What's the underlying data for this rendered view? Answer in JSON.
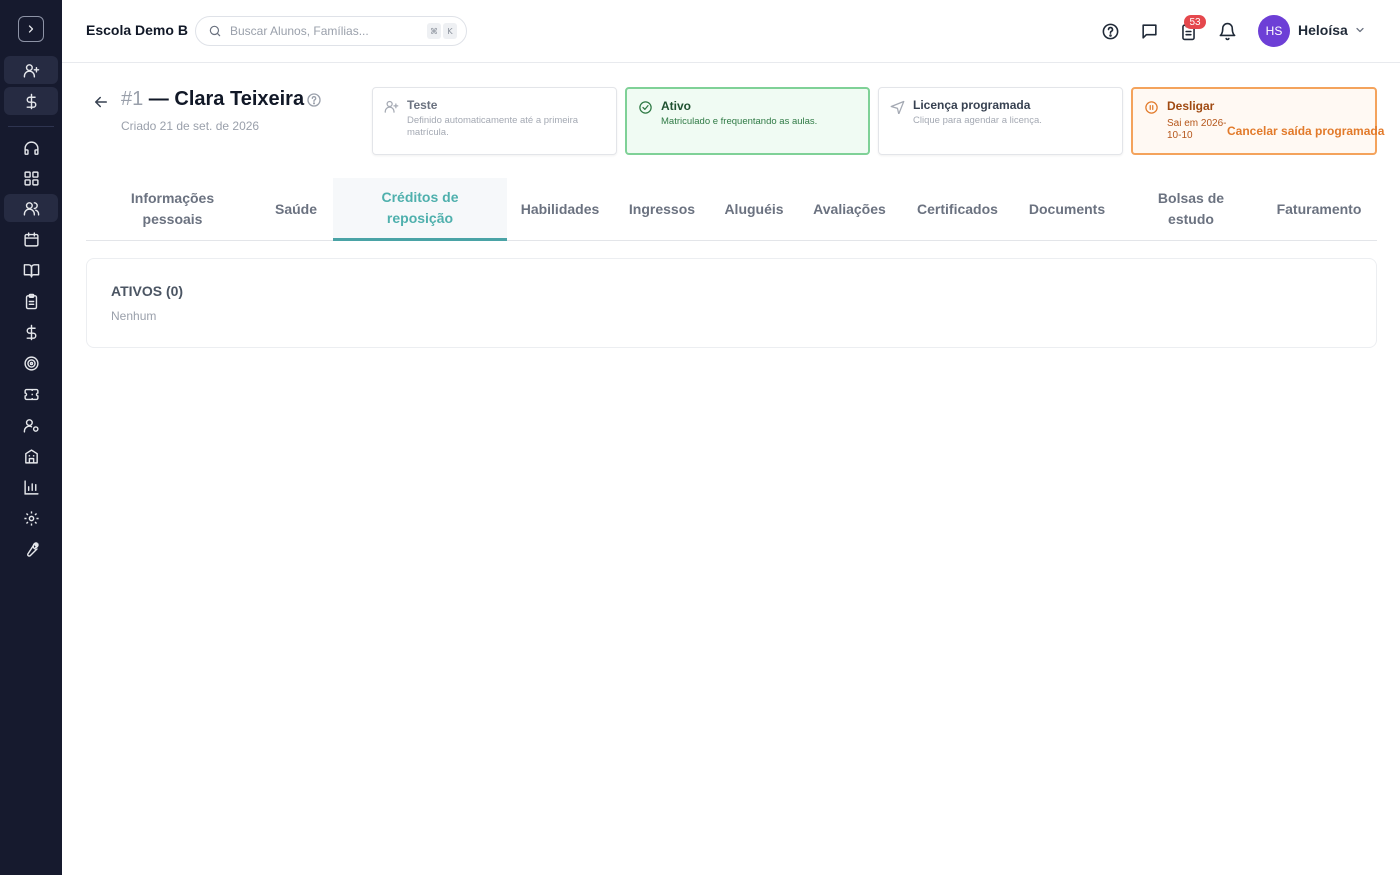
{
  "app": {
    "school_name": "Escola Demo B",
    "search": {
      "placeholder": "Buscar Alunos, Famílias...",
      "shortcut": [
        "⌘",
        "K"
      ]
    },
    "notifications_badge": "53",
    "user": {
      "initials": "HS",
      "name": "Heloísa",
      "avatar_color": "#6d3fd6"
    }
  },
  "sidebar": {
    "icons": [
      "chevron-right-icon",
      "user-plus-icon",
      "dollar-icon",
      "headset-icon",
      "grid-icon",
      "users-icon",
      "calendar-icon",
      "book-open-icon",
      "clipboard-icon",
      "dollar-icon",
      "target-icon",
      "ticket-icon",
      "user-cog-icon",
      "building-icon",
      "bar-chart-icon",
      "settings-icon",
      "wrench-icon"
    ]
  },
  "student": {
    "number": "#1",
    "separator": " — ",
    "name": "Clara Teixeira",
    "created": "Criado 21 de set. de 2026"
  },
  "statuses": {
    "test": {
      "title": "Teste",
      "desc": "Definido automaticamente até a primeira matrícula."
    },
    "active": {
      "title": "Ativo",
      "desc": "Matriculado e frequentando as aulas."
    },
    "leave": {
      "title": "Licença programada",
      "desc": "Clique para agendar a licença."
    },
    "off": {
      "title": "Desligar",
      "desc": "Sai em 2026-10-10",
      "action": "Cancelar saída programada"
    }
  },
  "tabs": [
    {
      "label": "Informações pessoais"
    },
    {
      "label": "Saúde"
    },
    {
      "label": "Créditos de reposição"
    },
    {
      "label": "Habilidades"
    },
    {
      "label": "Ingressos"
    },
    {
      "label": "Aluguéis"
    },
    {
      "label": "Avaliações"
    },
    {
      "label": "Certificados"
    },
    {
      "label": "Documents"
    },
    {
      "label": "Bolsas de estudo"
    },
    {
      "label": "Faturamento"
    }
  ],
  "active_tab": "Créditos de reposição",
  "credits": {
    "section_title": "ATIVOS (0)",
    "empty_text": "Nenhum"
  },
  "colors": {
    "sidebar_bg": "#161a2e",
    "accent": "#4aa3a6",
    "active_green": "#7fd197",
    "off_orange": "#f4a35c",
    "badge_red": "#e5484d"
  }
}
